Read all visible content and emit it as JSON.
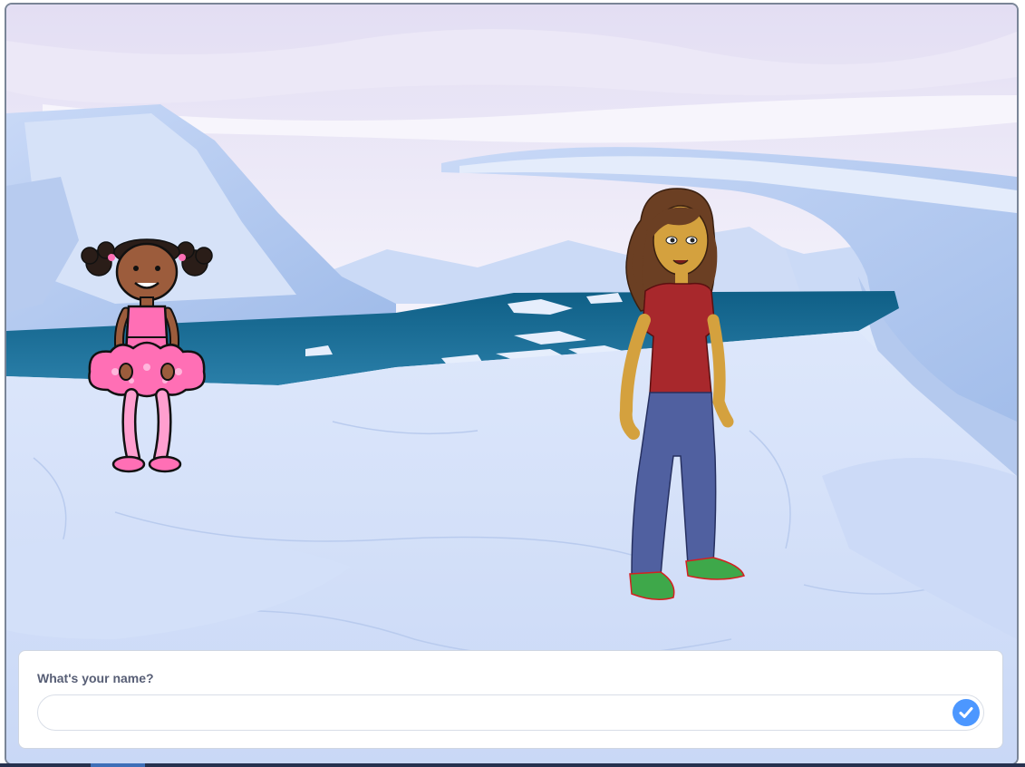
{
  "stage": {
    "backdrop_name": "arctic-backdrop",
    "sprites": [
      "ballerina-sprite",
      "girl-sprite"
    ]
  },
  "ask": {
    "question": "What's your name?",
    "input_value": "",
    "placeholder": "",
    "submit_icon": "check-icon"
  },
  "colors": {
    "accent": "#4c97ff",
    "question_text": "#575e75",
    "stage_border": "#7a8597"
  }
}
